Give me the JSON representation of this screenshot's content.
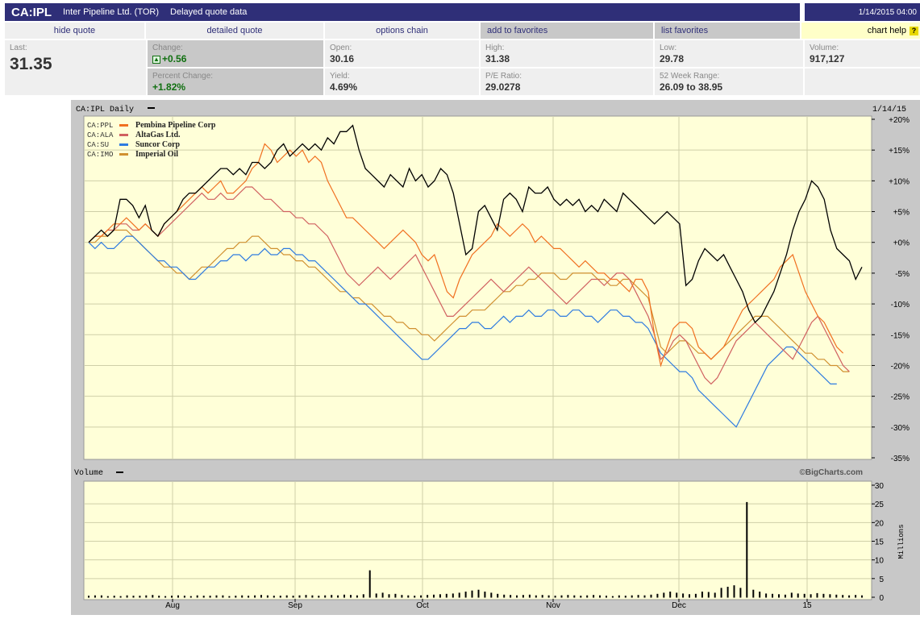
{
  "header": {
    "ticker": "CA:IPL",
    "company": "Inter Pipeline Ltd. (TOR)",
    "delay_note": "Delayed quote data",
    "datetime": "1/14/2015 04:00"
  },
  "nav": {
    "hide_quote": "hide quote",
    "detailed_quote": "detailed quote",
    "options_chain": "options chain",
    "add_favorites": "add to favorites",
    "list_favorites": "list favorites",
    "chart_help": "chart help",
    "help_glyph": "?"
  },
  "quote": {
    "last_label": "Last:",
    "last": "31.35",
    "change_label": "Change:",
    "change": "+0.56",
    "pct_label": "Percent Change:",
    "pct": "+1.82%",
    "open_label": "Open:",
    "open": "30.16",
    "yield_label": "Yield:",
    "yield": "4.69%",
    "high_label": "High:",
    "high": "31.38",
    "pe_label": "P/E Ratio:",
    "pe": "29.0278",
    "low_label": "Low:",
    "low": "29.78",
    "range_label": "52 Week Range:",
    "range": "26.09 to 38.95",
    "volume_label": "Volume:",
    "volume": "917,127"
  },
  "chart": {
    "title": "CA:IPL Daily",
    "date": "1/14/15",
    "volume_title": "Volume",
    "credit": "©BigCharts.com",
    "millions_label": "Millions",
    "price_colors": {
      "CA:IPL": "#000000",
      "CA:PPL": "#f07020",
      "CA:ALA": "#d06060",
      "CA:SU": "#2e7be0",
      "CA:IMO": "#d09030"
    }
  },
  "chart_data": [
    {
      "type": "line",
      "title": "CA:IPL Daily",
      "ylabel": "",
      "ylim": [
        -35,
        20
      ],
      "yticks": [
        "+20%",
        "+15%",
        "+10%",
        "+5%",
        "+0%",
        "-5%",
        "-10%",
        "-15%",
        "-20%",
        "-25%",
        "-30%",
        "-35%"
      ],
      "xticks": [
        "Aug",
        "Sep",
        "Oct",
        "Nov",
        "Dec",
        "15"
      ],
      "grid": true,
      "legend_position": "top-left",
      "legend": [
        {
          "code": "CA:PPL",
          "name": "Pembina Pipeline Corp"
        },
        {
          "code": "CA:ALA",
          "name": "AltaGas Ltd."
        },
        {
          "code": "CA:SU",
          "name": "Suncor Corp"
        },
        {
          "code": "CA:IMO",
          "name": "Imperial Oil"
        }
      ],
      "series": [
        {
          "name": "CA:IPL",
          "values": [
            0,
            1,
            2,
            1,
            2,
            7,
            7,
            6,
            4,
            6,
            2,
            1,
            3,
            4,
            5,
            7,
            8,
            8,
            9,
            10,
            11,
            12,
            12,
            11,
            12,
            11,
            13,
            13,
            12,
            13,
            15,
            16,
            14,
            15,
            16,
            15,
            16,
            15,
            17,
            16,
            18,
            18,
            19,
            15,
            12,
            11,
            10,
            9,
            11,
            10,
            9,
            12,
            10,
            11,
            9,
            10,
            12,
            11,
            8,
            3,
            -2,
            -1,
            5,
            6,
            4,
            2,
            7,
            8,
            7,
            5,
            9,
            8,
            8,
            9,
            7,
            6,
            7,
            6,
            7,
            5,
            6,
            5,
            7,
            6,
            5,
            8,
            7,
            6,
            5,
            4,
            3,
            4,
            5,
            4,
            3,
            -7,
            -6,
            -3,
            -1,
            -2,
            -3,
            -2,
            -4,
            -6,
            -8,
            -11,
            -13,
            -12,
            -10,
            -8,
            -5,
            -2,
            2,
            5,
            7,
            10,
            9,
            7,
            2,
            -1,
            -2,
            -3,
            -6,
            -4
          ]
        },
        {
          "name": "CA:PPL",
          "values": [
            0,
            1,
            1,
            2,
            3,
            3,
            4,
            3,
            2,
            3,
            2,
            1,
            3,
            4,
            5,
            6,
            7,
            8,
            9,
            8,
            9,
            10,
            8,
            8,
            9,
            10,
            12,
            13,
            16,
            15,
            13,
            14,
            15,
            14,
            15,
            13,
            14,
            13,
            10,
            8,
            6,
            4,
            4,
            3,
            2,
            1,
            0,
            -1,
            0,
            1,
            2,
            1,
            0,
            -2,
            -3,
            -2,
            -5,
            -8,
            -9,
            -6,
            -4,
            -2,
            -1,
            0,
            1,
            3,
            2,
            1,
            2,
            3,
            2,
            0,
            1,
            0,
            -1,
            -1,
            -2,
            -3,
            -4,
            -3,
            -4,
            -5,
            -5,
            -6,
            -6,
            -7,
            -8,
            -6,
            -6,
            -8,
            -15,
            -20,
            -17,
            -14,
            -13,
            -13,
            -14,
            -17,
            -18,
            -19,
            -18,
            -17,
            -15,
            -13,
            -11,
            -10,
            -9,
            -8,
            -7,
            -6,
            -4,
            -3,
            -2,
            -5,
            -8,
            -10,
            -12,
            -13,
            -15,
            -17,
            -18
          ]
        },
        {
          "name": "CA:ALA",
          "values": [
            0,
            1,
            1,
            2,
            2,
            3,
            3,
            2,
            2,
            3,
            2,
            1,
            2,
            3,
            4,
            5,
            6,
            7,
            8,
            7,
            7,
            8,
            7,
            7,
            8,
            9,
            9,
            8,
            7,
            7,
            6,
            5,
            5,
            4,
            4,
            3,
            3,
            2,
            1,
            -1,
            -3,
            -5,
            -6,
            -7,
            -6,
            -5,
            -4,
            -5,
            -6,
            -5,
            -4,
            -3,
            -2,
            -4,
            -6,
            -8,
            -10,
            -12,
            -12,
            -11,
            -10,
            -9,
            -8,
            -7,
            -6,
            -7,
            -8,
            -7,
            -6,
            -5,
            -4,
            -5,
            -6,
            -7,
            -8,
            -9,
            -10,
            -9,
            -8,
            -7,
            -6,
            -6,
            -7,
            -6,
            -5,
            -5,
            -6,
            -8,
            -10,
            -12,
            -15,
            -19,
            -18,
            -16,
            -15,
            -16,
            -18,
            -20,
            -22,
            -23,
            -22,
            -20,
            -18,
            -16,
            -15,
            -14,
            -13,
            -14,
            -15,
            -16,
            -17,
            -18,
            -19,
            -17,
            -15,
            -13,
            -12,
            -14,
            -16,
            -18,
            -20,
            -21
          ]
        },
        {
          "name": "CA:SU",
          "values": [
            0,
            -1,
            0,
            -1,
            -1,
            0,
            1,
            1,
            0,
            -1,
            -2,
            -3,
            -3,
            -4,
            -4,
            -5,
            -6,
            -6,
            -5,
            -4,
            -4,
            -3,
            -3,
            -2,
            -2,
            -3,
            -2,
            -2,
            -1,
            -2,
            -2,
            -1,
            -1,
            -2,
            -2,
            -3,
            -3,
            -4,
            -5,
            -6,
            -7,
            -8,
            -9,
            -10,
            -10,
            -11,
            -12,
            -13,
            -14,
            -15,
            -16,
            -17,
            -18,
            -19,
            -19,
            -18,
            -17,
            -16,
            -15,
            -14,
            -14,
            -13,
            -13,
            -14,
            -14,
            -13,
            -12,
            -13,
            -12,
            -12,
            -11,
            -12,
            -12,
            -11,
            -11,
            -12,
            -12,
            -11,
            -11,
            -12,
            -12,
            -13,
            -12,
            -11,
            -11,
            -12,
            -12,
            -13,
            -13,
            -14,
            -16,
            -18,
            -19,
            -20,
            -21,
            -21,
            -22,
            -24,
            -25,
            -26,
            -27,
            -28,
            -29,
            -30,
            -28,
            -26,
            -24,
            -22,
            -20,
            -19,
            -18,
            -17,
            -17,
            -18,
            -19,
            -20,
            -21,
            -22,
            -23,
            -23
          ]
        },
        {
          "name": "CA:IMO",
          "values": [
            0,
            0,
            1,
            1,
            2,
            2,
            2,
            1,
            0,
            -1,
            -2,
            -3,
            -4,
            -4,
            -5,
            -5,
            -6,
            -5,
            -4,
            -4,
            -3,
            -2,
            -1,
            -1,
            0,
            0,
            1,
            1,
            0,
            -1,
            -1,
            -2,
            -2,
            -3,
            -3,
            -4,
            -4,
            -5,
            -6,
            -7,
            -8,
            -8,
            -9,
            -9,
            -10,
            -10,
            -11,
            -12,
            -12,
            -13,
            -13,
            -14,
            -14,
            -15,
            -15,
            -16,
            -15,
            -14,
            -13,
            -12,
            -12,
            -11,
            -11,
            -11,
            -10,
            -9,
            -8,
            -8,
            -7,
            -7,
            -6,
            -6,
            -5,
            -5,
            -5,
            -6,
            -6,
            -5,
            -5,
            -5,
            -5,
            -6,
            -6,
            -7,
            -7,
            -6,
            -6,
            -7,
            -8,
            -9,
            -13,
            -17,
            -18,
            -17,
            -16,
            -16,
            -17,
            -18,
            -18,
            -19,
            -18,
            -17,
            -16,
            -15,
            -14,
            -13,
            -12,
            -12,
            -12,
            -13,
            -14,
            -15,
            -16,
            -17,
            -18,
            -18,
            -19,
            -19,
            -20,
            -20,
            -21,
            -21
          ]
        }
      ]
    },
    {
      "type": "bar",
      "title": "Volume",
      "ylabel": "Millions",
      "ylim": [
        0,
        30
      ],
      "yticks": [
        "0",
        "5",
        "10",
        "15",
        "20",
        "25",
        "30"
      ],
      "values": [
        0.4,
        0.5,
        0.5,
        0.3,
        0.4,
        0.3,
        0.5,
        0.4,
        0.4,
        0.5,
        0.6,
        0.4,
        0.3,
        0.4,
        0.5,
        0.4,
        0.3,
        0.5,
        0.4,
        0.4,
        0.5,
        0.5,
        0.3,
        0.4,
        0.5,
        0.4,
        0.5,
        0.6,
        0.5,
        0.4,
        0.4,
        0.5,
        0.4,
        0.5,
        0.6,
        0.5,
        0.4,
        0.5,
        0.6,
        0.5,
        0.7,
        0.6,
        0.5,
        0.8,
        7.2,
        1.0,
        1.2,
        0.8,
        0.9,
        0.6,
        0.5,
        0.4,
        0.5,
        0.6,
        0.7,
        0.8,
        0.9,
        1.0,
        1.2,
        1.5,
        1.8,
        2.0,
        1.5,
        1.2,
        0.9,
        0.7,
        0.6,
        0.5,
        0.6,
        0.7,
        0.5,
        0.6,
        0.5,
        0.4,
        0.5,
        0.6,
        0.5,
        0.4,
        0.5,
        0.6,
        0.5,
        0.4,
        0.3,
        0.5,
        0.4,
        0.5,
        0.6,
        0.5,
        0.7,
        0.9,
        1.2,
        1.5,
        1.2,
        1.0,
        0.8,
        0.9,
        1.5,
        1.4,
        1.2,
        2.5,
        2.8,
        3.2,
        2.5,
        25.5,
        2.0,
        1.5,
        1.0,
        0.9,
        0.8,
        0.7,
        1.2,
        1.0,
        0.9,
        0.8,
        1.1,
        0.9,
        0.8,
        0.7,
        0.6,
        0.5,
        0.6,
        0.5
      ]
    }
  ]
}
